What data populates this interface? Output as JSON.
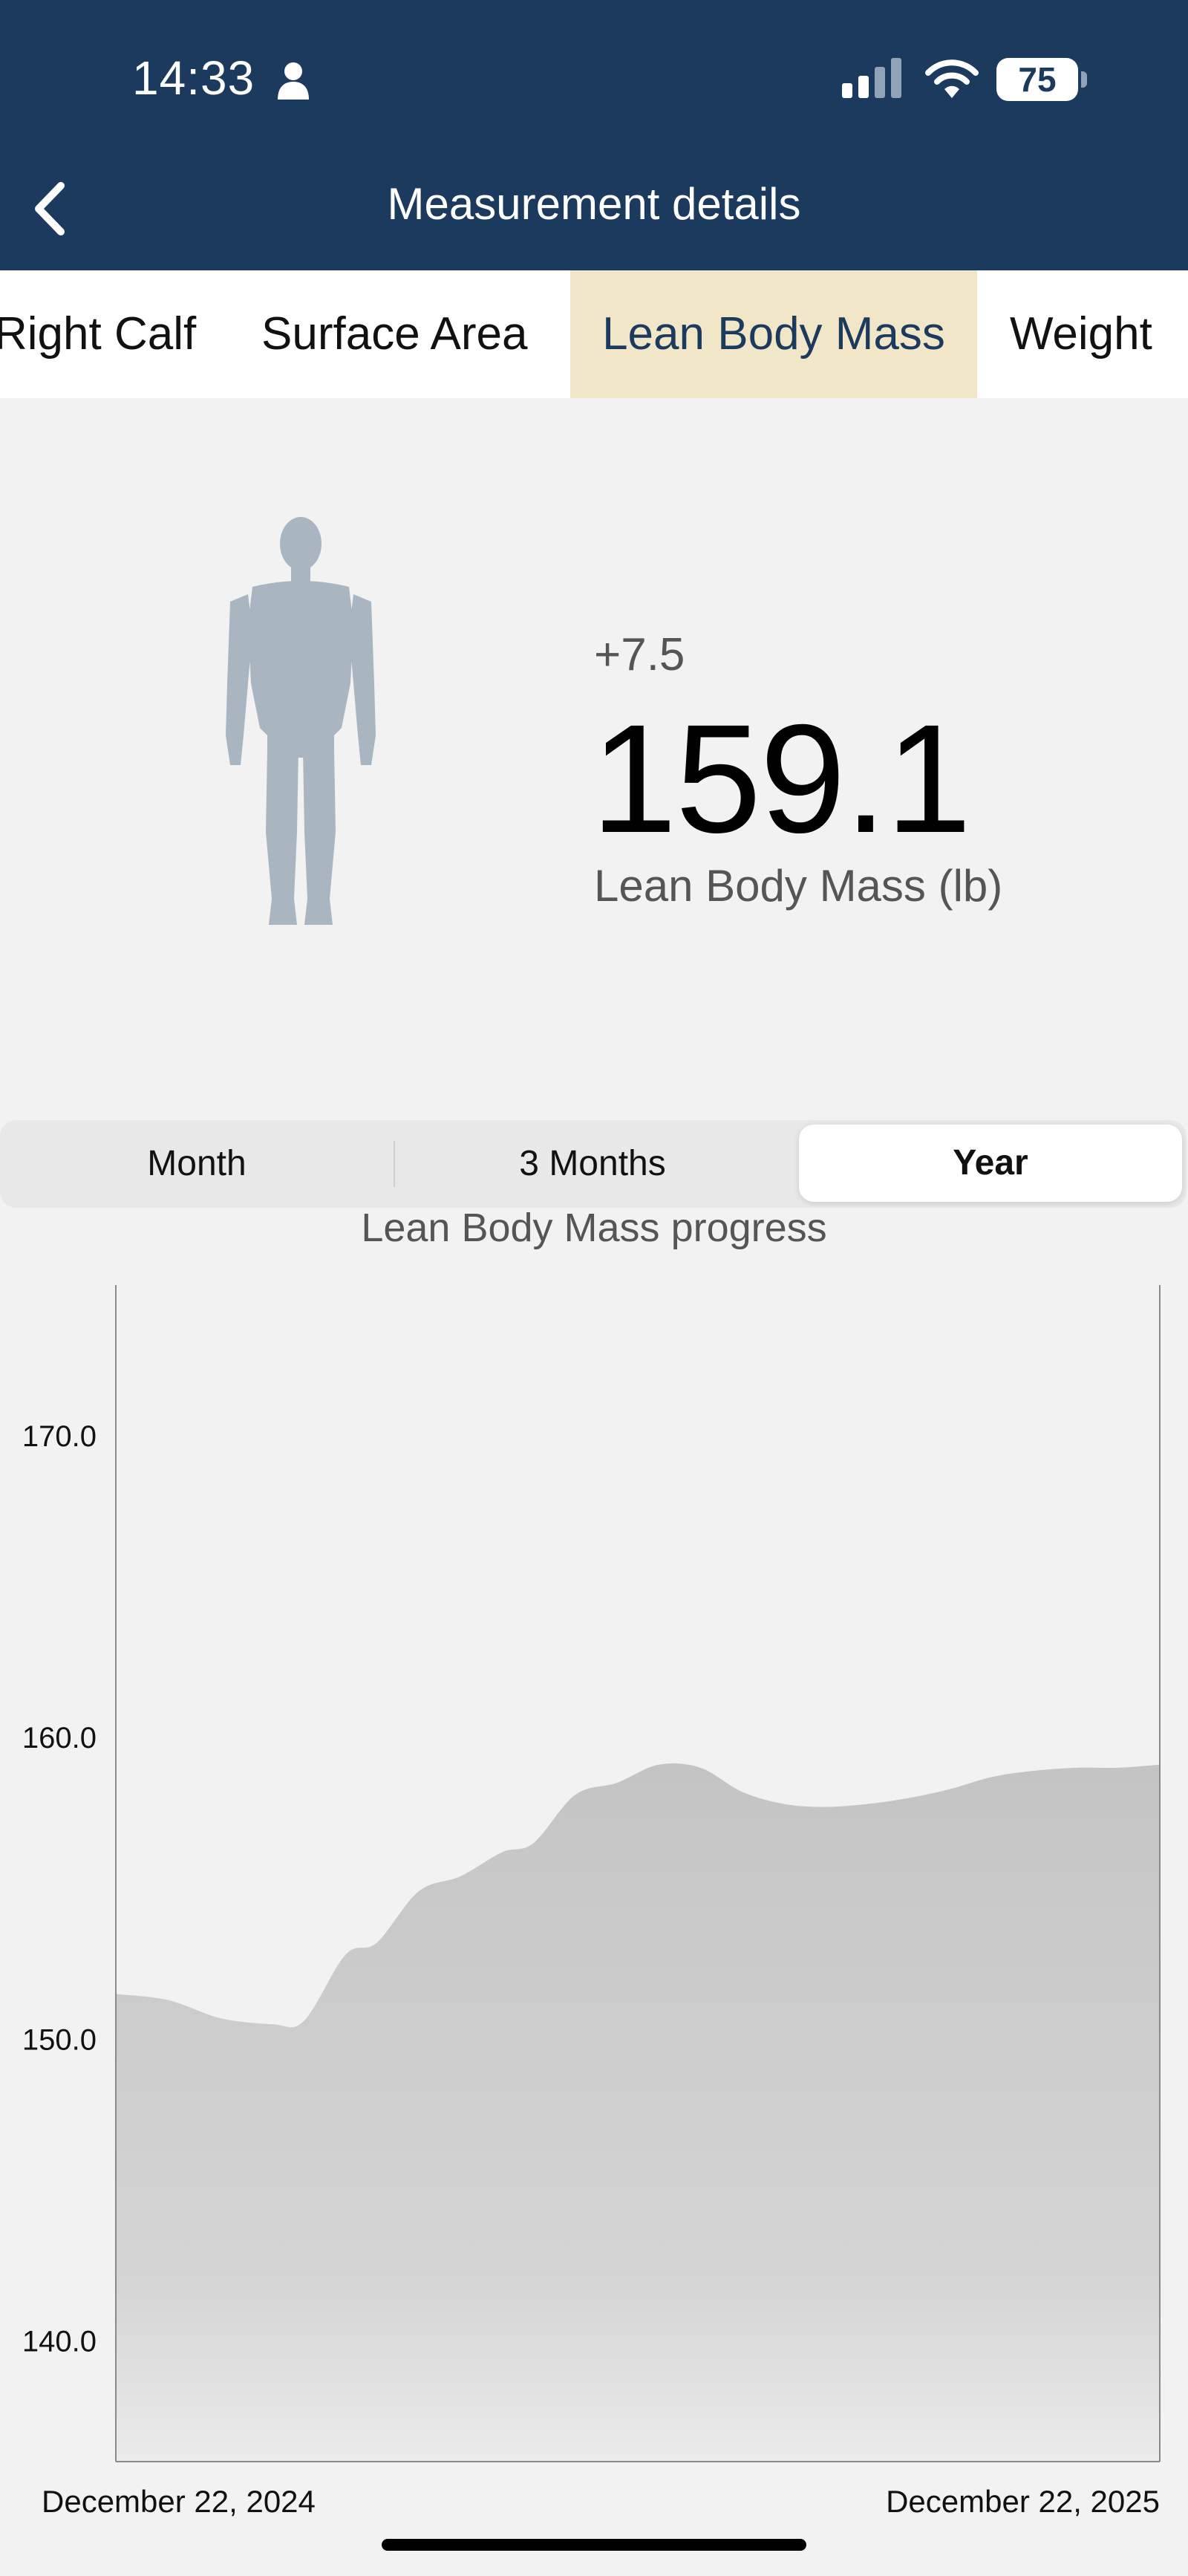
{
  "status_bar": {
    "time": "14:33",
    "battery": "75",
    "icons": [
      "person-icon",
      "signal-icon",
      "wifi-icon",
      "battery-icon"
    ]
  },
  "nav": {
    "title": "Measurement details",
    "back_icon": "chevron-left-icon"
  },
  "tabs": [
    {
      "label": "Right Calf"
    },
    {
      "label": "Surface Area"
    },
    {
      "label": "Lean Body Mass"
    },
    {
      "label": "Weight"
    }
  ],
  "summary": {
    "change": "+7.5",
    "value": "159.1",
    "label": "Lean Body Mass (lb)",
    "figure_icon": "human-body-icon"
  },
  "range": {
    "options": [
      "Month",
      "3 Months",
      "Year"
    ],
    "selected": "Year"
  },
  "colors": {
    "header": "#1b3a5e",
    "active_tab": "#f2e6c9",
    "area_fill": "#c5c6c5",
    "figure": "#a9b6c1"
  },
  "chart_data": {
    "type": "area",
    "title": "Lean Body Mass progress",
    "ylim": [
      136,
      175
    ],
    "yticks": [
      140.0,
      150.0,
      160.0,
      170.0
    ],
    "ytick_labels": [
      "140.0",
      "150.0",
      "160.0",
      "170.0"
    ],
    "xlabels": [
      "December 22, 2024",
      "December 22, 2025"
    ],
    "grid": false,
    "series": [
      {
        "x": [
          0,
          0.05,
          0.1,
          0.15,
          0.18,
          0.22,
          0.25,
          0.29,
          0.33,
          0.37,
          0.4,
          0.44,
          0.48,
          0.52,
          0.56,
          0.6,
          0.64,
          0.68,
          0.72,
          0.76,
          0.8,
          0.84,
          0.88,
          0.92,
          0.96,
          1
        ],
        "values": [
          151.5,
          151.3,
          150.7,
          150.5,
          150.6,
          152.8,
          153.2,
          154.9,
          155.4,
          156.2,
          156.5,
          158.1,
          158.5,
          159.1,
          159.0,
          158.2,
          157.8,
          157.7,
          157.8,
          158.0,
          158.3,
          158.7,
          158.9,
          159.0,
          159.0,
          159.1
        ]
      }
    ]
  }
}
